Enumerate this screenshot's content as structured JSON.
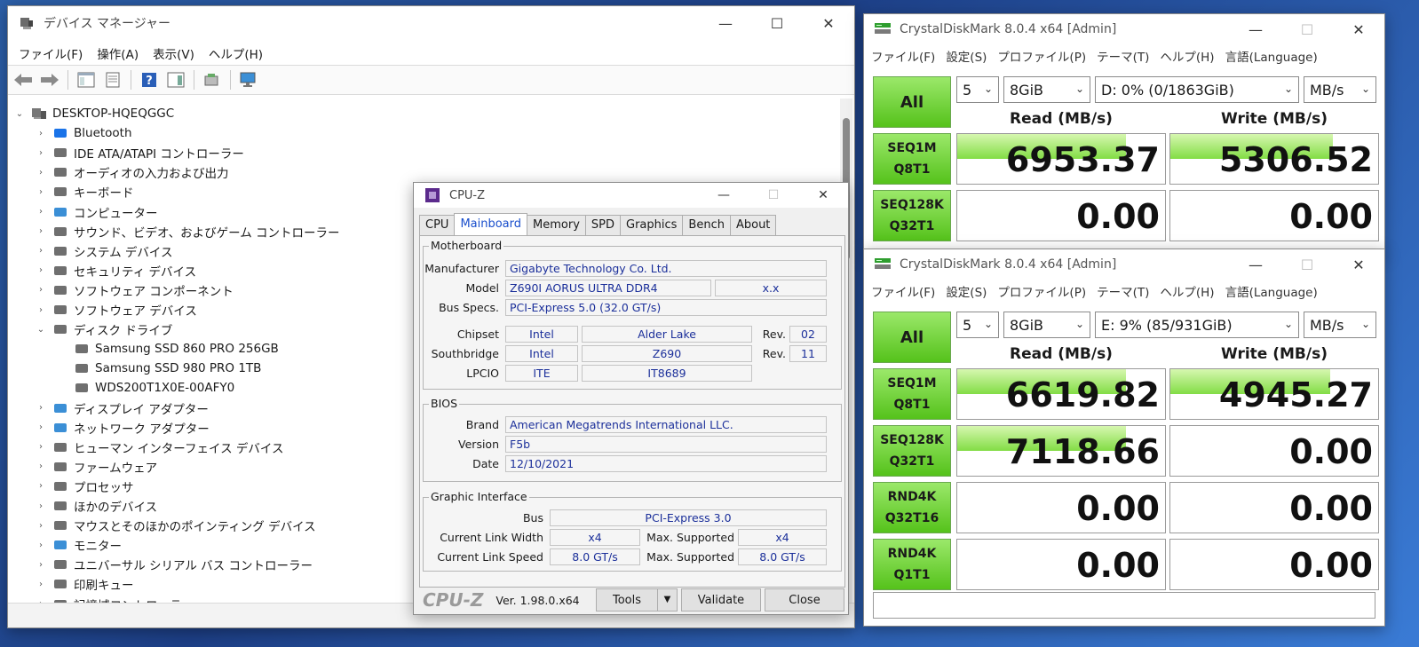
{
  "devmgr": {
    "title": "デバイス マネージャー",
    "menu": [
      "ファイル(F)",
      "操作(A)",
      "表示(V)",
      "ヘルプ(H)"
    ],
    "root": "DESKTOP-HQEQGGC",
    "items": [
      {
        "label": "Bluetooth",
        "icon": "bluetooth-icon",
        "expanded": false
      },
      {
        "label": "IDE ATA/ATAPI コントローラー",
        "icon": "ide-controller-icon",
        "expanded": false
      },
      {
        "label": "オーディオの入力および出力",
        "icon": "speaker-icon",
        "expanded": false
      },
      {
        "label": "キーボード",
        "icon": "keyboard-icon",
        "expanded": false
      },
      {
        "label": "コンピューター",
        "icon": "monitor-icon",
        "expanded": false
      },
      {
        "label": "サウンド、ビデオ、およびゲーム コントローラー",
        "icon": "speaker-icon",
        "expanded": false
      },
      {
        "label": "システム デバイス",
        "icon": "system-device-icon",
        "expanded": false
      },
      {
        "label": "セキュリティ デバイス",
        "icon": "security-key-icon",
        "expanded": false
      },
      {
        "label": "ソフトウェア コンポーネント",
        "icon": "software-component-icon",
        "expanded": false
      },
      {
        "label": "ソフトウェア デバイス",
        "icon": "software-device-icon",
        "expanded": false
      },
      {
        "label": "ディスク ドライブ",
        "icon": "disk-drive-icon",
        "expanded": true
      },
      {
        "label": "Samsung SSD 860 PRO 256GB",
        "icon": "disk-drive-icon",
        "child": true
      },
      {
        "label": "Samsung SSD 980 PRO 1TB",
        "icon": "disk-drive-icon",
        "child": true
      },
      {
        "label": "WDS200T1X0E-00AFY0",
        "icon": "disk-drive-icon",
        "child": true
      },
      {
        "label": "ディスプレイ アダプター",
        "icon": "display-adapter-icon",
        "expanded": false
      },
      {
        "label": "ネットワーク アダプター",
        "icon": "network-adapter-icon",
        "expanded": false
      },
      {
        "label": "ヒューマン インターフェイス デバイス",
        "icon": "hid-icon",
        "expanded": false
      },
      {
        "label": "ファームウェア",
        "icon": "firmware-icon",
        "expanded": false
      },
      {
        "label": "プロセッサ",
        "icon": "processor-icon",
        "expanded": false
      },
      {
        "label": "ほかのデバイス",
        "icon": "other-device-icon",
        "expanded": false
      },
      {
        "label": "マウスとそのほかのポインティング デバイス",
        "icon": "mouse-icon",
        "expanded": false
      },
      {
        "label": "モニター",
        "icon": "monitor-icon",
        "expanded": false
      },
      {
        "label": "ユニバーサル シリアル バス コントローラー",
        "icon": "usb-icon",
        "expanded": false
      },
      {
        "label": "印刷キュー",
        "icon": "printer-icon",
        "expanded": false
      },
      {
        "label": "記憶域コントローラー",
        "icon": "storage-controller-icon",
        "expanded": false
      }
    ]
  },
  "cpuz": {
    "title": "CPU-Z",
    "tabs": [
      "CPU",
      "Mainboard",
      "Memory",
      "SPD",
      "Graphics",
      "Bench",
      "About"
    ],
    "active_tab": "Mainboard",
    "motherboard": {
      "group": "Motherboard",
      "manufacturer_label": "Manufacturer",
      "manufacturer": "Gigabyte Technology Co. Ltd.",
      "model_label": "Model",
      "model": "Z690I AORUS ULTRA DDR4",
      "model_rev": "x.x",
      "bus_label": "Bus Specs.",
      "bus": "PCI-Express 5.0 (32.0 GT/s)",
      "chipset_label": "Chipset",
      "chipset_vendor": "Intel",
      "chipset_name": "Alder Lake",
      "chipset_rev_label": "Rev.",
      "chipset_rev": "02",
      "southbridge_label": "Southbridge",
      "southbridge_vendor": "Intel",
      "southbridge_name": "Z690",
      "southbridge_rev_label": "Rev.",
      "southbridge_rev": "11",
      "lpcio_label": "LPCIO",
      "lpcio_vendor": "ITE",
      "lpcio_name": "IT8689"
    },
    "bios": {
      "group": "BIOS",
      "brand_label": "Brand",
      "brand": "American Megatrends International LLC.",
      "version_label": "Version",
      "version": "F5b",
      "date_label": "Date",
      "date": "12/10/2021"
    },
    "graphic": {
      "group": "Graphic Interface",
      "bus_label": "Bus",
      "bus": "PCI-Express 3.0",
      "width_label": "Current Link Width",
      "width": "x4",
      "width_max_label": "Max. Supported",
      "width_max": "x4",
      "speed_label": "Current Link Speed",
      "speed": "8.0 GT/s",
      "speed_max_label": "Max. Supported",
      "speed_max": "8.0 GT/s"
    },
    "footer": {
      "logo": "CPU-Z",
      "version": "Ver. 1.98.0.x64",
      "tools": "Tools",
      "validate": "Validate",
      "close": "Close"
    }
  },
  "cdm1": {
    "title": "CrystalDiskMark 8.0.4 x64 [Admin]",
    "menu": [
      "ファイル(F)",
      "設定(S)",
      "プロファイル(P)",
      "テーマ(T)",
      "ヘルプ(H)",
      "言語(Language)"
    ],
    "all": "All",
    "count": "5",
    "size": "8GiB",
    "drive": "D: 0% (0/1863GiB)",
    "unit": "MB/s",
    "read_header": "Read (MB/s)",
    "write_header": "Write (MB/s)",
    "rows": [
      {
        "line1": "SEQ1M",
        "line2": "Q8T1",
        "read": "6953.37",
        "write": "5306.52",
        "read_fill": 0.81,
        "write_fill": 0.78
      },
      {
        "line1": "SEQ128K",
        "line2": "Q32T1",
        "read": "0.00",
        "write": "0.00",
        "read_fill": 0,
        "write_fill": 0
      }
    ]
  },
  "cdm2": {
    "title": "CrystalDiskMark 8.0.4 x64 [Admin]",
    "menu": [
      "ファイル(F)",
      "設定(S)",
      "プロファイル(P)",
      "テーマ(T)",
      "ヘルプ(H)",
      "言語(Language)"
    ],
    "all": "All",
    "count": "5",
    "size": "8GiB",
    "drive": "E: 9% (85/931GiB)",
    "unit": "MB/s",
    "read_header": "Read (MB/s)",
    "write_header": "Write (MB/s)",
    "rows": [
      {
        "line1": "SEQ1M",
        "line2": "Q8T1",
        "read": "6619.82",
        "write": "4945.27",
        "read_fill": 0.81,
        "write_fill": 0.77
      },
      {
        "line1": "SEQ128K",
        "line2": "Q32T1",
        "read": "7118.66",
        "write": "0.00",
        "read_fill": 0.81,
        "write_fill": 0
      },
      {
        "line1": "RND4K",
        "line2": "Q32T16",
        "read": "0.00",
        "write": "0.00",
        "read_fill": 0,
        "write_fill": 0
      },
      {
        "line1": "RND4K",
        "line2": "Q1T1",
        "read": "0.00",
        "write": "0.00",
        "read_fill": 0,
        "write_fill": 0
      }
    ]
  }
}
